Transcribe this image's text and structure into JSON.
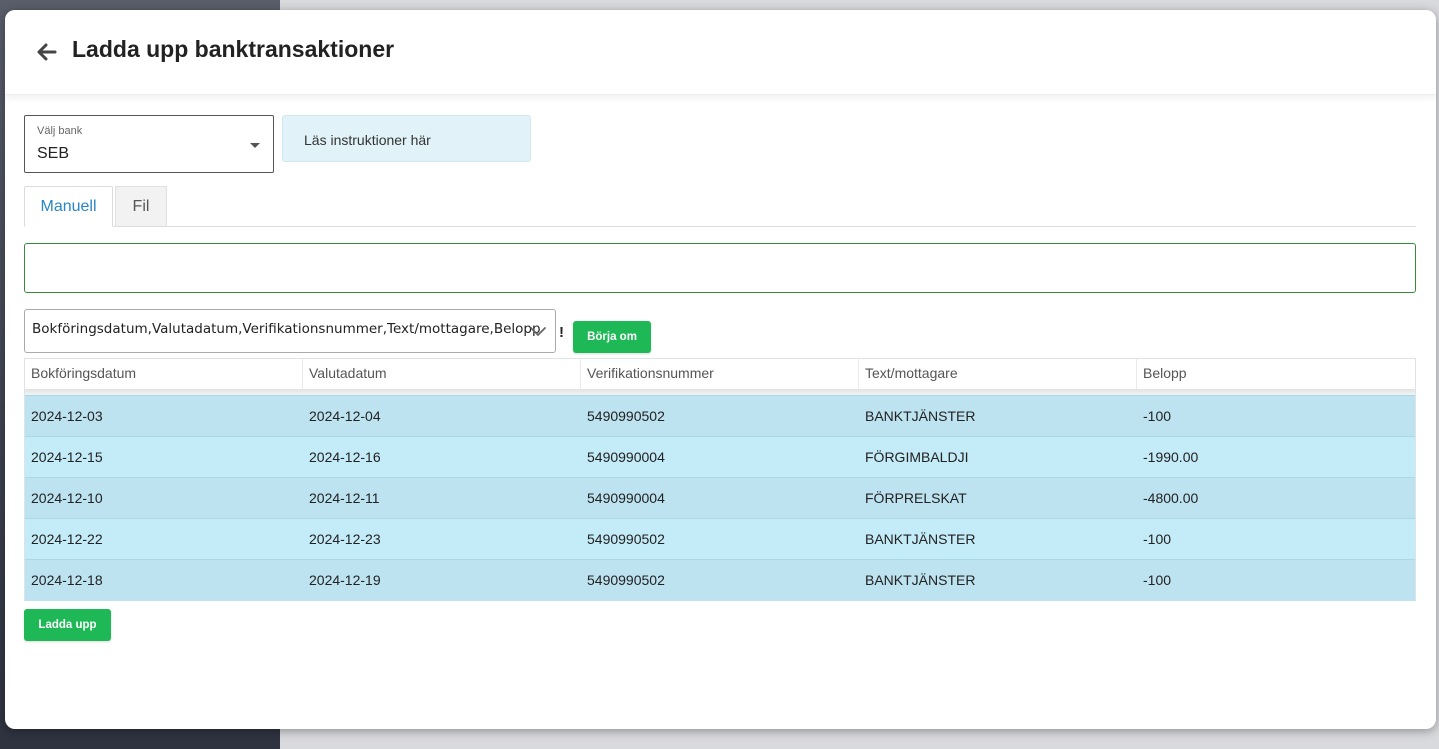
{
  "header": {
    "title": "Ladda upp banktransaktioner",
    "back_icon": "arrow-left-icon"
  },
  "bank_select": {
    "label": "Välj bank",
    "value": "SEB"
  },
  "instructions": {
    "label": "Läs instruktioner här"
  },
  "tabs": [
    {
      "label": "Manuell",
      "active": true
    },
    {
      "label": "Fil",
      "active": false
    }
  ],
  "paste_input": {
    "value": ""
  },
  "columns_select": {
    "value": "Bokföringsdatum,Valutadatum,Verifikationsnummer,Text/mottagare,Belopp",
    "warning": "!"
  },
  "buttons": {
    "reset": "Börja om",
    "upload": "Ladda upp"
  },
  "table": {
    "columns": [
      "Bokföringsdatum",
      "Valutadatum",
      "Verifikationsnummer",
      "Text/mottagare",
      "Belopp"
    ],
    "rows": [
      [
        "2024-12-03",
        "2024-12-04",
        "5490990502",
        "BANKTJÄNSTER",
        "-100"
      ],
      [
        "2024-12-15",
        "2024-12-16",
        "5490990004",
        "FÖRGIMBALDJI",
        "-1990.00"
      ],
      [
        "2024-12-10",
        "2024-12-11",
        "5490990004",
        "FÖRPRELSKAT",
        "-4800.00"
      ],
      [
        "2024-12-22",
        "2024-12-23",
        "5490990502",
        "BANKTJÄNSTER",
        "-100"
      ],
      [
        "2024-12-18",
        "2024-12-19",
        "5490990502",
        "BANKTJÄNSTER",
        "-100"
      ]
    ]
  },
  "colors": {
    "accent_green": "#1fb857",
    "tab_active_blue": "#2a86c8",
    "row_odd": "#bde3f1",
    "row_even": "#c3ebf8",
    "info_box": "#e1f3f8"
  }
}
